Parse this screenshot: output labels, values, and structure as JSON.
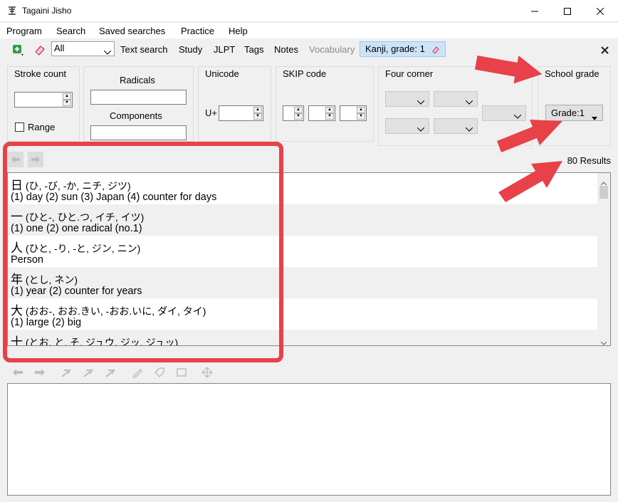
{
  "window": {
    "title": "Tagaini Jisho"
  },
  "menu": [
    "Program",
    "Search",
    "Saved searches",
    "Practice",
    "Help"
  ],
  "toolbar": {
    "filter_select": "All",
    "links": [
      "Text search",
      "Study",
      "JLPT",
      "Tags",
      "Notes",
      "Vocabulary"
    ],
    "active_filter": "Kanji, grade: 1"
  },
  "filters": {
    "stroke_count_label": "Stroke count",
    "range_label": "Range",
    "radicals_label": "Radicals",
    "components_label": "Components",
    "unicode_label": "Unicode",
    "unicode_prefix": "U+",
    "skip_label": "SKIP code",
    "four_corner_label": "Four corner",
    "school_grade_label": "School grade",
    "grade_value": "Grade:1"
  },
  "results": {
    "count_text": "80 Results",
    "entries": [
      {
        "kanji": "日",
        "readings": "(ひ, -び, -か, ニチ, ジツ)",
        "meaning": "(1) day (2) sun (3) Japan (4) counter for days"
      },
      {
        "kanji": "一",
        "readings": "(ひと-, ひと.つ, イチ, イツ)",
        "meaning": "(1) one (2) one radical (no.1)"
      },
      {
        "kanji": "人",
        "readings": "(ひと, -り, -と, ジン, ニン)",
        "meaning": "Person"
      },
      {
        "kanji": "年",
        "readings": "(とし, ネン)",
        "meaning": "(1) year (2) counter for years"
      },
      {
        "kanji": "大",
        "readings": "(おお-, おお.きい, -おお.いに, ダイ, タイ)",
        "meaning": "(1) large (2) big"
      },
      {
        "kanji": "十",
        "readings": "(とお, と, そ, ジュウ, ジッ, ジュッ)",
        "meaning": ""
      }
    ]
  },
  "colors": {
    "highlight": "#e8414a",
    "arrow": "#e8414a",
    "active_filter_bg": "#cce4f7"
  }
}
